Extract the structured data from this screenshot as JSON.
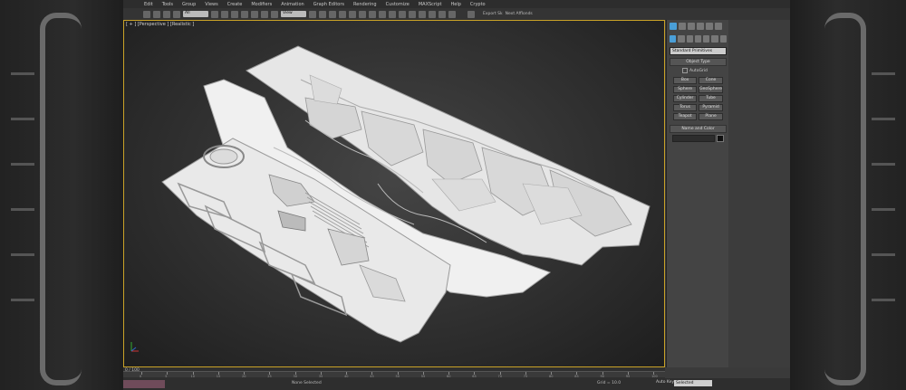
{
  "menu": [
    "Edit",
    "Tools",
    "Group",
    "Views",
    "Create",
    "Modifiers",
    "Animation",
    "Graph Editors",
    "Rendering",
    "Customize",
    "MAXScript",
    "Help",
    "Crypto"
  ],
  "toolbar": {
    "selection_filter": "All",
    "view_dropdown": "View",
    "export_label": "Export Sk",
    "next_label": "Next Afflonds"
  },
  "viewport": {
    "label": "[ + ] [Perspective ] [Realistic ]"
  },
  "command_panel": {
    "category": "Standard Primitives",
    "object_type_title": "Object Type",
    "autogrid": "AutoGrid",
    "buttons": [
      "Box",
      "Cone",
      "Sphere",
      "GeoSphere",
      "Cylinder",
      "Tube",
      "Torus",
      "Pyramid",
      "Teapot",
      "Plane"
    ],
    "name_color_title": "Name and Color"
  },
  "timeline": {
    "frame_label": "0 / 100",
    "ticks": [
      "0",
      "5",
      "10",
      "15",
      "20",
      "25",
      "30",
      "35",
      "40",
      "45",
      "50",
      "55",
      "60",
      "65",
      "70",
      "75",
      "80",
      "85",
      "90",
      "95",
      "100"
    ]
  },
  "status": {
    "selection_text": "None Selected",
    "grid_text": "Grid = 10.0",
    "autokey": "Auto Key",
    "selected_dropdown": "Selected"
  },
  "colors": {
    "viewport_border": "#c9a227",
    "accent": "#4a9fd8",
    "status_lead": "#6f4b5a"
  }
}
